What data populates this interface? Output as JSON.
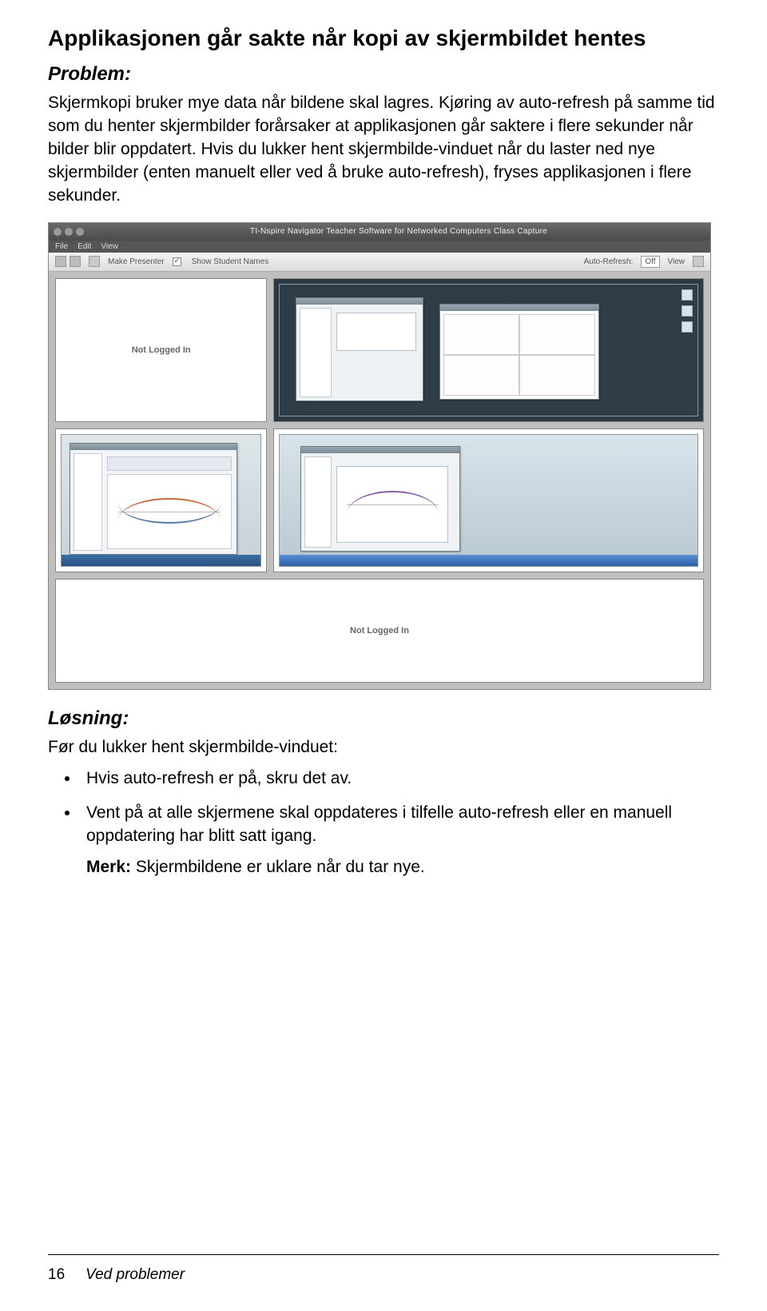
{
  "heading": "Applikasjonen går sakte når kopi av skjermbildet hentes",
  "problem_label": "Problem:",
  "problem_text": "Skjermkopi bruker mye data når bildene skal lagres. Kjøring av auto-refresh på samme tid som du henter skjermbilder forårsaker at applikasjonen går saktere i flere sekunder når bilder blir oppdatert. Hvis du lukker hent skjermbilde-vinduet når du laster ned nye skjermbilder (enten manuelt eller ved å bruke auto-refresh), fryses applikasjonen i flere sekunder.",
  "solution_label": "Løsning:",
  "solution_intro": "Før du lukker hent skjermbilde-vinduet:",
  "bullet1": "Hvis auto-refresh er på, skru det av.",
  "bullet2": "Vent på at alle skjermene skal oppdateres i tilfelle auto-refresh eller en manuell oppdatering har blitt satt igang.",
  "note_label": "Merk:",
  "note_text": " Skjermbildene er uklare når du tar nye.",
  "page_number": "16",
  "footer_section": "Ved problemer",
  "app": {
    "title": "TI-Nspire Navigator Teacher Software for Networked Computers Class Capture",
    "menu": {
      "file": "File",
      "edit": "Edit",
      "view": "View"
    },
    "toolbar": {
      "make_presenter": "Make Presenter",
      "show_names": "Show Student Names",
      "auto_refresh_label": "Auto-Refresh:",
      "auto_refresh_value": "Off",
      "view_label": "View"
    },
    "not_logged_in": "Not Logged In"
  }
}
